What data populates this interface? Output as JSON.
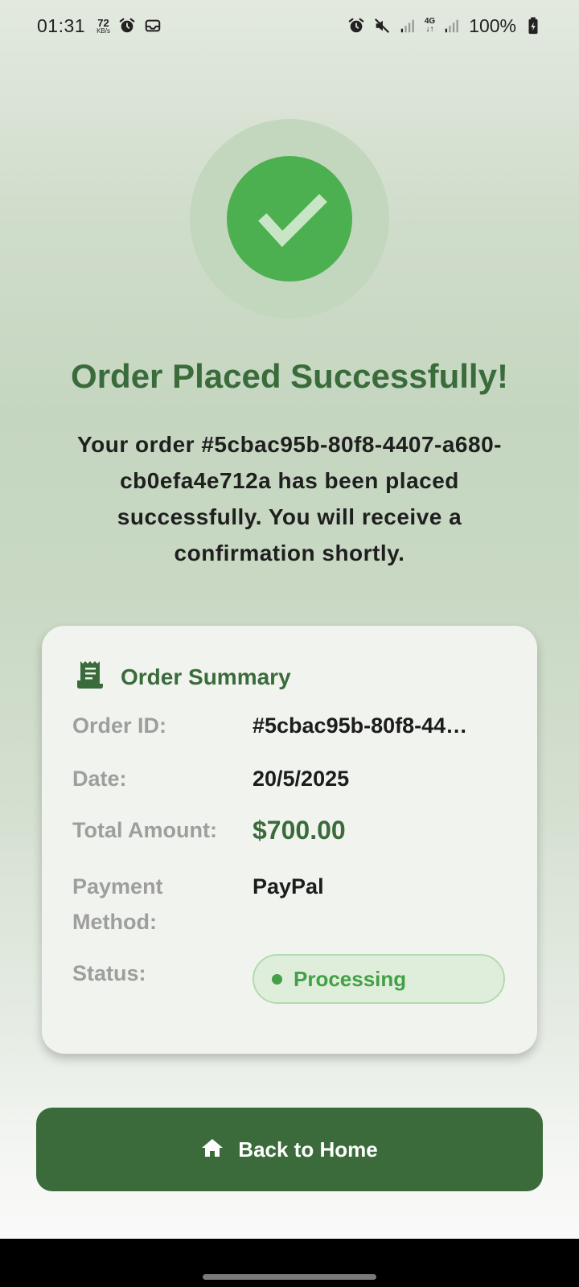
{
  "status_bar": {
    "time": "01:31",
    "net_speed_value": "72",
    "net_speed_unit": "KB/s",
    "network_type": "4G",
    "battery_percent": "100%",
    "icons": [
      "alarm-icon",
      "mail-icon",
      "alarm-icon",
      "mute-icon",
      "signal-icon",
      "signal-icon",
      "battery-charging-icon"
    ]
  },
  "success": {
    "icon": "checkmark-icon",
    "title": "Order Placed Successfully!",
    "message": "Your order #5cbac95b-80f8-4407-a680-cb0efa4e712a has been placed successfully. You will receive a confirmation shortly."
  },
  "summary": {
    "icon": "receipt-icon",
    "title": "Order Summary",
    "order_id_label": "Order ID:",
    "order_id_value": "#5cbac95b-80f8-44…",
    "date_label": "Date:",
    "date_value": "20/5/2025",
    "total_label": "Total Amount:",
    "total_value": "$700.00",
    "payment_label_line1": "Payment",
    "payment_label_line2": "Method:",
    "payment_value": "PayPal",
    "status_label": "Status:",
    "status_value": "Processing"
  },
  "actions": {
    "home_icon": "home-icon",
    "home_label": "Back to Home"
  },
  "colors": {
    "primary": "#3b6b3a",
    "success": "#4caf50",
    "status_green": "#43a047"
  }
}
